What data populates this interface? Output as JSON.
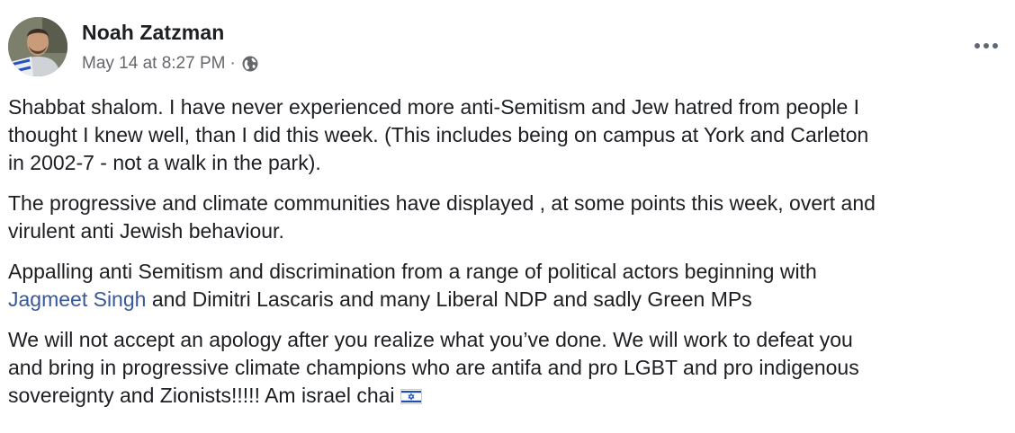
{
  "post": {
    "author": "Noah Zatzman",
    "timestamp": "May 14 at 8:27 PM",
    "separator": "·",
    "privacy_icon": "globe-icon",
    "more_icon": "more-options-icon",
    "link_color": "#385898",
    "paragraphs": {
      "p1_line1": "Shabbat shalom. I have never experienced more anti-Semitism and Jew hatred from people I",
      "p1_line2": "thought I knew well, than I did this week. (This includes being on campus at York and Carleton",
      "p1_line3": "in 2002-7 - not a walk in the park).",
      "p2_line1": "The progressive and climate communities have displayed , at some points this week, overt and",
      "p2_line2": "virulent anti Jewish behaviour.",
      "p3_line1": "Appalling anti Semitism and discrimination from a range of political actors beginning with",
      "p3_link": "Jagmeet Singh",
      "p3_line2_rest": " and Dimitri Lascaris and many Liberal NDP and sadly Green MPs",
      "p4_line1": "We will not accept an apology after you realize what you’ve done.  We will work to defeat you",
      "p4_line2": "and bring in progressive climate champions who are antifa and pro LGBT and pro indigenous",
      "p4_line3": "sovereignty and Zionists!!!!!   Am israel chai"
    },
    "emoji": "israel-flag-icon"
  }
}
